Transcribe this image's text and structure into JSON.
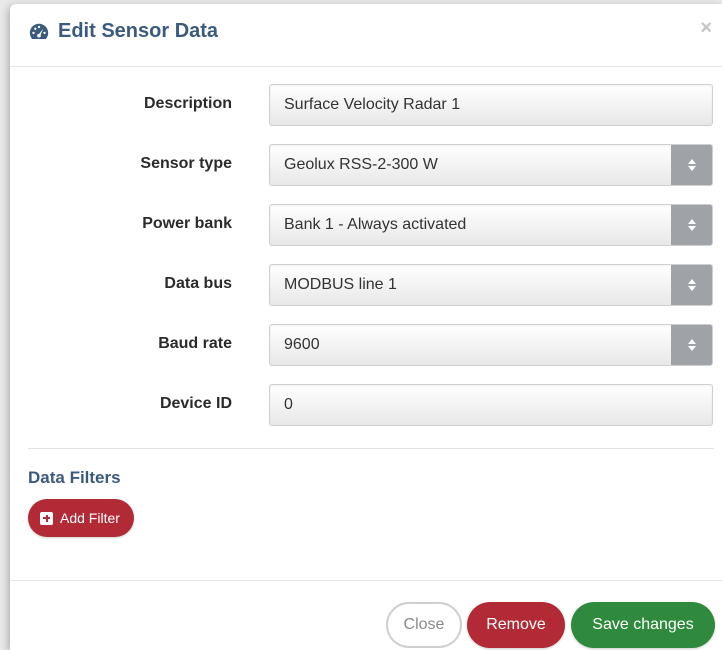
{
  "dialog": {
    "title": "Edit Sensor Data",
    "title_icon": "dashboard-icon",
    "close_symbol": "×"
  },
  "form": {
    "description": {
      "label": "Description",
      "value": "Surface Velocity Radar 1"
    },
    "sensor_type": {
      "label": "Sensor type",
      "value": "Geolux RSS-2-300 W"
    },
    "power_bank": {
      "label": "Power bank",
      "value": "Bank 1 - Always activated"
    },
    "data_bus": {
      "label": "Data bus",
      "value": "MODBUS line 1"
    },
    "baud_rate": {
      "label": "Baud rate",
      "value": "9600"
    },
    "device_id": {
      "label": "Device ID",
      "value": "0"
    }
  },
  "filters": {
    "section_title": "Data Filters",
    "add_label": "Add Filter"
  },
  "footer": {
    "close_label": "Close",
    "remove_label": "Remove",
    "save_label": "Save changes"
  },
  "colors": {
    "title": "#3a5a7e",
    "danger": "#b22a36",
    "success": "#2f8a3e",
    "select_arrow_bg": "#9fa3a8"
  }
}
